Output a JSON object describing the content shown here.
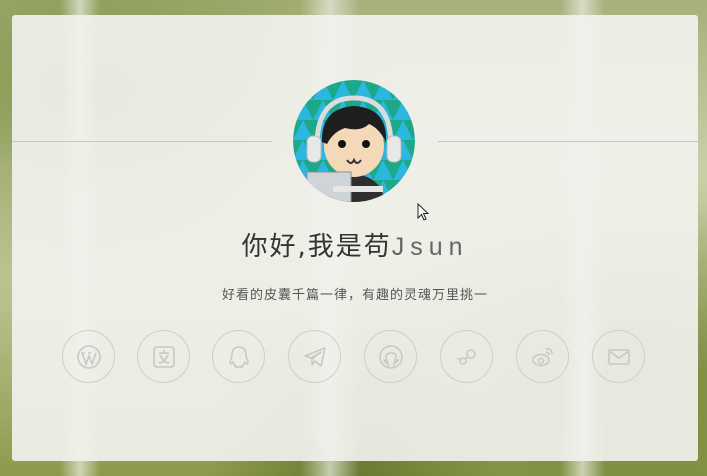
{
  "profile": {
    "greeting": "你好,我是苟",
    "name": "Jsun",
    "motto": "好看的皮囊千篇一律，有趣的灵魂万里挑一"
  },
  "colors": {
    "card": "#f3f3f0",
    "divider": "#c6c6c2",
    "icon_stroke": "#c8c8c4",
    "avatar_ring": "#1a9e7e"
  },
  "social_links": [
    {
      "icon": "wordpress-icon"
    },
    {
      "icon": "translate-icon"
    },
    {
      "icon": "qq-icon"
    },
    {
      "icon": "telegram-icon"
    },
    {
      "icon": "github-icon"
    },
    {
      "icon": "steam-icon"
    },
    {
      "icon": "weibo-icon"
    },
    {
      "icon": "email-icon"
    }
  ]
}
